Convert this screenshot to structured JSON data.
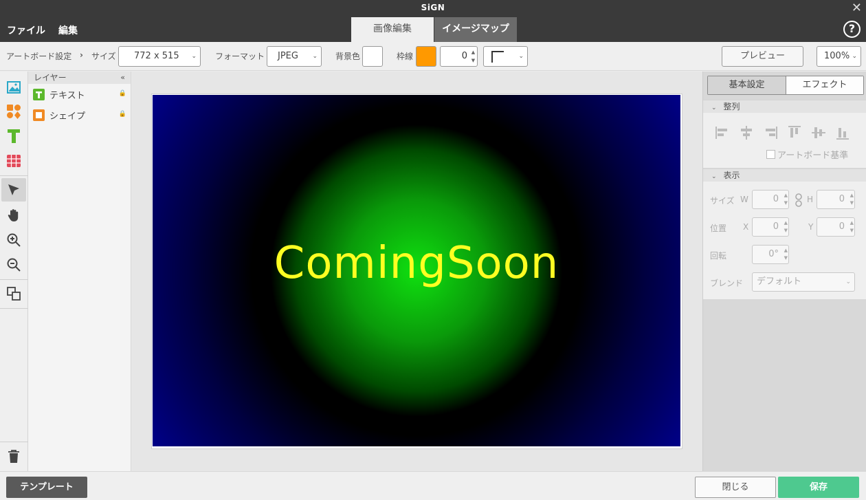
{
  "window": {
    "title": "SiGN"
  },
  "menu": {
    "items": [
      "ファイル",
      "編集"
    ]
  },
  "tabs": {
    "active": "画像編集",
    "inactive": "イメージマップ"
  },
  "toolbar": {
    "artboard_label": "アートボード設定",
    "size_label": "サイズ",
    "size_value": "772 x 515",
    "format_label": "フォーマット",
    "format_value": "JPEG",
    "bg_label": "背景色",
    "bg_color": "#ffffff",
    "border_label": "枠線",
    "border_color": "#ff9900",
    "border_width": "0",
    "preview_label": "プレビュー",
    "zoom_value": "100%"
  },
  "layers": {
    "header": "レイヤー",
    "items": [
      {
        "label": "テキスト",
        "icon": "text-layer-icon"
      },
      {
        "label": "シェイプ",
        "icon": "shape-layer-icon"
      }
    ]
  },
  "canvas": {
    "text": "ComingSoon",
    "text_color": "#ffff22"
  },
  "right_panel": {
    "tab_basic": "基本設定",
    "tab_effect": "エフェクト",
    "align_header": "整列",
    "artboard_base": "アートボード基準",
    "display_header": "表示",
    "size_label": "サイズ",
    "w_label": "W",
    "w_value": "0",
    "h_label": "H",
    "h_value": "0",
    "position_label": "位置",
    "x_label": "X",
    "x_value": "0",
    "y_label": "Y",
    "y_value": "0",
    "rotate_label": "回転",
    "rotate_value": "0°",
    "blend_label": "ブレンド",
    "blend_value": "デフォルト"
  },
  "bottom": {
    "template": "テンプレート",
    "close": "閉じる",
    "save": "保存"
  }
}
